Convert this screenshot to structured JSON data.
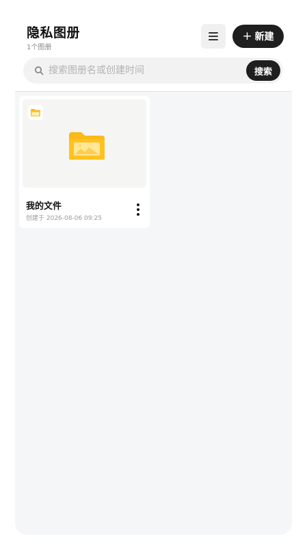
{
  "header": {
    "title": "隐私图册",
    "subtitle": "1个图册",
    "new_button_plus": "+",
    "new_button_label": "新建"
  },
  "search": {
    "placeholder": "搜索图册名或创建时间",
    "value": "",
    "button_label": "搜索"
  },
  "albums": [
    {
      "name": "我的文件",
      "created": "创建于 2026-08-06 09:25",
      "icon": "folder-image-icon"
    }
  ],
  "colors": {
    "accent_dark": "#1f1f1f",
    "folder_yellow": "#fbb91a",
    "folder_light": "#ffd866",
    "content_bg": "#f5f6f8"
  },
  "icons": {
    "menu": "hamburger-menu-icon",
    "search": "search-icon",
    "more": "more-vertical-icon",
    "badge": "folder-icon"
  }
}
